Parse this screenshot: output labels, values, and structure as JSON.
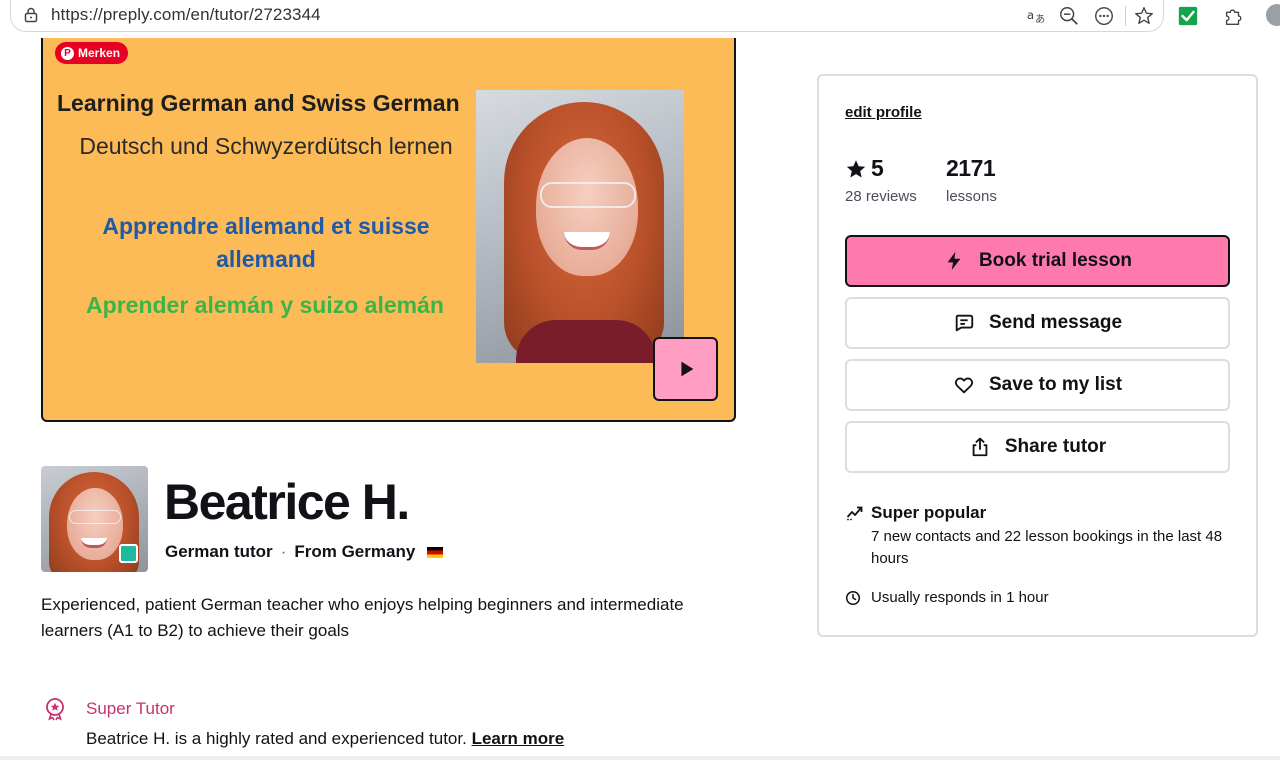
{
  "browser": {
    "url": "https://preply.com/en/tutor/2723344",
    "icons": [
      "lock-icon",
      "translate-icon",
      "zoom-out-icon",
      "more-icon",
      "favorite-star-icon",
      "extension-check-icon",
      "extensions-puzzle-icon"
    ]
  },
  "video": {
    "pin_label": "Merken",
    "line1": "Learning German and Swiss German",
    "line2": "Deutsch und Schwyzerdütsch lernen",
    "line3": "Apprendre allemand et suisse allemand",
    "line4": "Aprender alemán y suizo alemán",
    "colors": {
      "background": "#fdbb57",
      "play_button": "#ff9dc2",
      "french": "#1f5aa8",
      "spanish": "#3bb54a"
    }
  },
  "profile": {
    "name": "Beatrice H.",
    "role": "German tutor",
    "origin": "From Germany",
    "separator": "·",
    "tagline": "Experienced, patient German teacher who enjoys helping beginners and intermediate learners (A1 to B2) to achieve their goals",
    "super_tutor": {
      "title": "Super Tutor",
      "description": "Beatrice H. is a highly rated and experienced tutor.",
      "link": "Learn more"
    }
  },
  "side": {
    "edit_profile": "edit profile",
    "rating": "5",
    "reviews": "28 reviews",
    "lessons_count": "2171",
    "lessons_label": "lessons",
    "buttons": {
      "book": "Book trial lesson",
      "message": "Send message",
      "save": "Save to my list",
      "share": "Share tutor"
    },
    "popular_title": "Super popular",
    "popular_desc": "7 new contacts and 22 lesson bookings in the last 48 hours",
    "responds": "Usually responds in 1 hour",
    "colors": {
      "primary": "#ff7aac",
      "border": "#dcdce5",
      "super_tutor": "#c8316f"
    }
  }
}
